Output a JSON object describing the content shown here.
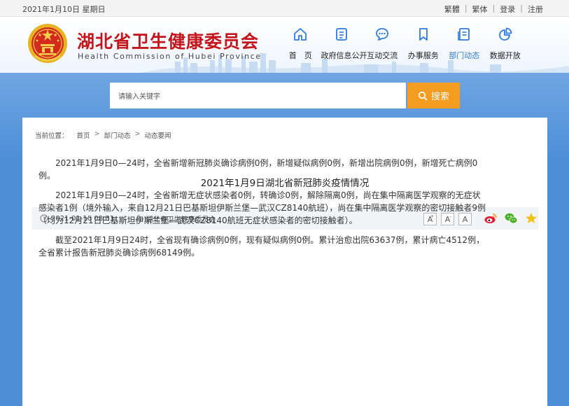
{
  "topbar": {
    "date": "2021年1月10日 星期日",
    "links": [
      "繁體",
      "繁体",
      "登录",
      "注册"
    ]
  },
  "header": {
    "title_cn": "湖北省卫生健康委员会",
    "title_en": "Health Commission of Hubei Province",
    "nav": [
      {
        "label": "首　页",
        "icon": "home-icon"
      },
      {
        "label": "政府信息公开",
        "icon": "document-icon"
      },
      {
        "label": "互动交流",
        "icon": "chat-icon"
      },
      {
        "label": "办事服务",
        "icon": "bookmark-icon"
      },
      {
        "label": "部门动态",
        "icon": "news-icon",
        "active": true
      },
      {
        "label": "数据开放",
        "icon": "pie-chart-icon"
      }
    ]
  },
  "search": {
    "placeholder": "请输入关键字",
    "button_label": "搜索"
  },
  "breadcrumb": {
    "label": "当前位置：",
    "items": [
      "首页",
      "部门动态",
      "动态要闻"
    ]
  },
  "article": {
    "title": "2021年1月9日湖北省新冠肺炎疫情情况",
    "datetime": "2021-01-10 08:31",
    "separator": "|",
    "source": "湖北省卫生健康委员会",
    "font_buttons": [
      "A",
      "A",
      "A"
    ],
    "share": [
      "weibo-icon",
      "wechat-icon",
      "favorite-star-icon"
    ],
    "paragraphs": [
      "2021年1月9日0—24时，全省新增新冠肺炎确诊病例0例，新增疑似病例0例，新增出院病例0例，新增死亡病例0例。",
      "2021年1月9日0—24时，全省新增无症状感染者0例，转确诊0例，解除隔离0例，尚在集中隔离医学观察的无症状感染者1例（境外输入，来自12月21日巴基斯坦伊斯兰堡—武汉CZ8140航班），尚在集中隔离医学观察的密切接触者9例（均为12月21日巴基斯坦伊斯兰堡—武汉CZ8140航班无症状感染者的密切接触者）。",
      "截至2021年1月9日24时，全省现有确诊病例0例，现有疑似病例0例。累计治愈出院63637例，累计病亡4512例，全省累计报告新冠肺炎确诊病例68149例。"
    ]
  },
  "colors": {
    "brand_red": "#c4161c",
    "band_blue": "#4f8fd8",
    "search_orange": "#f39c1f",
    "nav_active": "#2e7be0"
  }
}
